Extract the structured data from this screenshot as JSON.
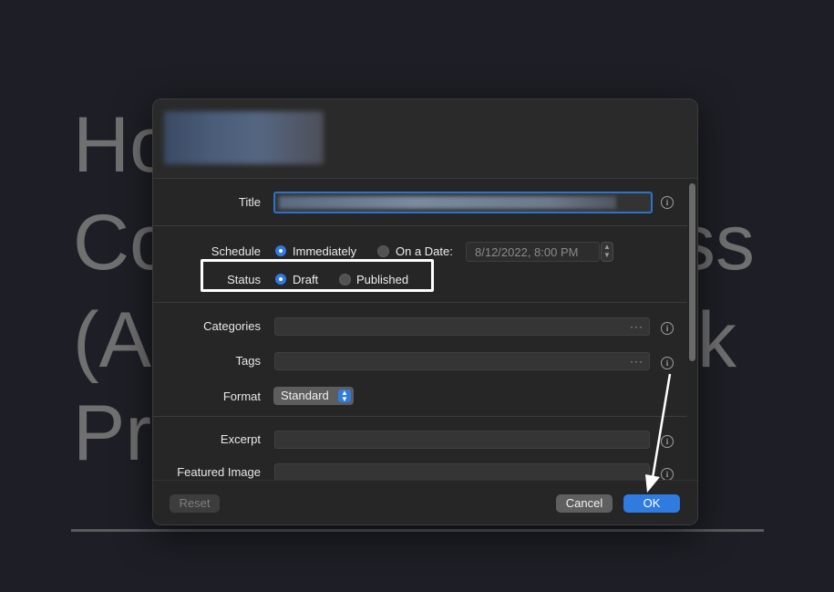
{
  "background": {
    "lines": [
      "Ho",
      "Co",
      "ss",
      "(A",
      "k",
      "Pr"
    ]
  },
  "form": {
    "title_label": "Title",
    "schedule_label": "Schedule",
    "schedule_immediately": "Immediately",
    "schedule_on_date": "On a Date:",
    "schedule_date_value": "8/12/2022,   8:00 PM",
    "status_label": "Status",
    "status_draft": "Draft",
    "status_published": "Published",
    "categories_label": "Categories",
    "tags_label": "Tags",
    "format_label": "Format",
    "format_value": "Standard",
    "excerpt_label": "Excerpt",
    "featured_image_label": "Featured Image",
    "more_glyph": "···",
    "info_glyph": "i"
  },
  "footer": {
    "reset_label": "Reset",
    "cancel_label": "Cancel",
    "ok_label": "OK"
  },
  "colors": {
    "accent": "#2f7be0",
    "highlight": "#ffffff"
  }
}
